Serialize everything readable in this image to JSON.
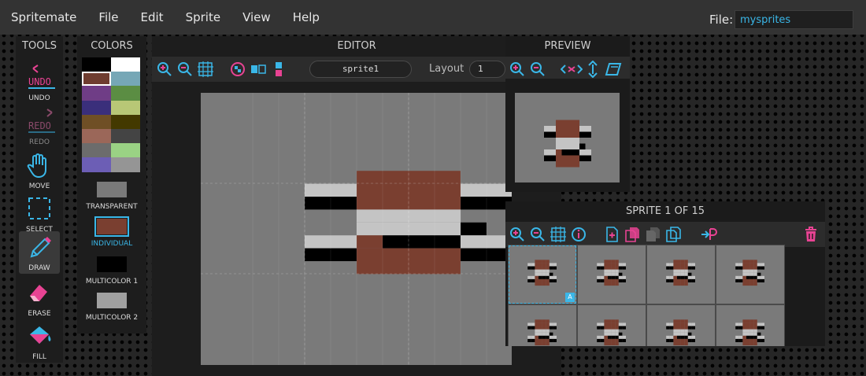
{
  "menubar": {
    "app_name": "Spritemate",
    "items": [
      "File",
      "Edit",
      "Sprite",
      "View",
      "Help"
    ],
    "file_label": "File:",
    "file_value": "mysprites"
  },
  "tools": {
    "title": "TOOLS",
    "items": [
      {
        "label": "UNDO",
        "icon": "undo-icon"
      },
      {
        "label": "REDO",
        "icon": "redo-icon"
      },
      {
        "label": "MOVE",
        "icon": "hand-icon"
      },
      {
        "label": "SELECT",
        "icon": "select-icon"
      },
      {
        "label": "DRAW",
        "icon": "pen-icon"
      },
      {
        "label": "ERASE",
        "icon": "eraser-icon"
      },
      {
        "label": "FILL",
        "icon": "fill-bucket-icon"
      }
    ],
    "undo_text": "UNDO",
    "redo_text": "REDO"
  },
  "colors": {
    "title": "COLORS",
    "palette": [
      "#000000",
      "#ffffff",
      "#6f3d30",
      "#76a7b6",
      "#6f3d86",
      "#5b8d43",
      "#3a2f7b",
      "#b8c776",
      "#6f4f25",
      "#433900",
      "#9b6759",
      "#444444",
      "#6c6c6c",
      "#9ad284",
      "#6c5eb5",
      "#959595"
    ],
    "selected_index": 2,
    "modes": [
      {
        "label": "TRANSPARENT",
        "color": "#7a7a7a"
      },
      {
        "label": "INDIVIDUAL",
        "color": "#7a3f30"
      },
      {
        "label": "MULTICOLOR 1",
        "color": "#000000"
      },
      {
        "label": "MULTICOLOR 2",
        "color": "#a0a0a0"
      }
    ],
    "active_mode": 1
  },
  "editor": {
    "title": "EDITOR",
    "sprite_name": "sprite1",
    "layout_label": "Layout",
    "layout_value": "1",
    "canvas_bg": "#7a7a7a"
  },
  "preview": {
    "title": "PREVIEW"
  },
  "sprites": {
    "title": "SPRITE 1 OF 15",
    "badge": "A",
    "thumb_count": 8
  },
  "sprite_pixels": {
    "cols": 12,
    "rows": 11,
    "palette_map": {
      "1": "#7a3f30",
      "2": "#000000",
      "3": "#c4c4c4"
    },
    "rows_data": [
      "000000000000",
      "000000000000",
      "000000000000",
      "000011110000",
      "003311113300",
      "002211112200",
      "000033330000",
      "000033332000",
      "003312223300",
      "002211112200",
      "000011110000"
    ]
  }
}
